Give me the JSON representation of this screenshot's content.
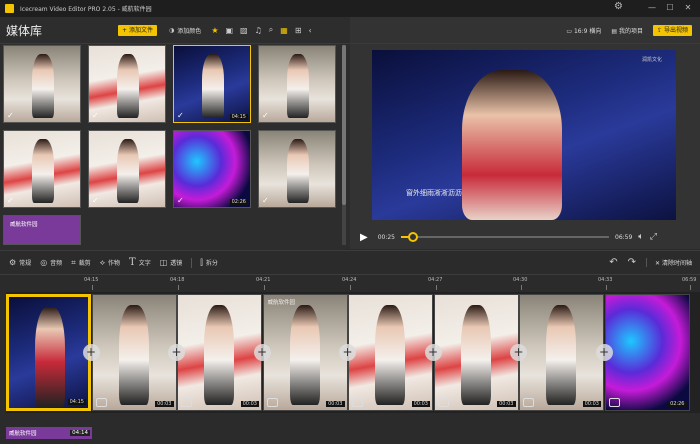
{
  "window": {
    "title": "Icecream Video Editor PRO 2.05 - 威航软件园"
  },
  "media": {
    "title": "媒体库",
    "add_file": "添加文件",
    "add_color": "添加颜色",
    "items": [
      {
        "style": "room",
        "checked": true,
        "duration": ""
      },
      {
        "style": "bed",
        "checked": true,
        "duration": ""
      },
      {
        "style": "stage",
        "checked": true,
        "duration": "04:15",
        "selected": true
      },
      {
        "style": "room",
        "checked": true,
        "duration": ""
      },
      {
        "style": "bed",
        "checked": true,
        "duration": ""
      },
      {
        "style": "bed",
        "checked": true,
        "duration": ""
      },
      {
        "style": "neon",
        "checked": true,
        "duration": "02:26"
      },
      {
        "style": "room",
        "checked": true,
        "duration": ""
      },
      {
        "style": "purple",
        "checked": false,
        "duration": "",
        "label": "威航软件园"
      }
    ]
  },
  "preview": {
    "aspect": "16:9 横向",
    "my_projects": "我的项目",
    "export": "导出视频",
    "caption": "窗外细雨淅淅沥沥",
    "watermark": "润凯文化",
    "current_time": "00:25",
    "total_time": "06:59",
    "progress": 0.06
  },
  "toolbar": {
    "general": "常规",
    "audio": "音频",
    "crop": "裁剪",
    "effects": "作物",
    "text": "文字",
    "transition": "透镜",
    "split": "拆分",
    "clear": "清除时间轴"
  },
  "timeline": {
    "ticks": [
      "04:15",
      "04:18",
      "04:21",
      "04:24",
      "04:27",
      "04:30",
      "04:33",
      "06:59"
    ],
    "clips": [
      {
        "style": "stage",
        "duration": "04:15",
        "active": true
      },
      {
        "style": "room",
        "duration": "00:03"
      },
      {
        "style": "bed",
        "duration": "00:03"
      },
      {
        "style": "room",
        "duration": "00:03",
        "label": "威航软件园"
      },
      {
        "style": "bed",
        "duration": "00:03"
      },
      {
        "style": "bed",
        "duration": "00:03"
      },
      {
        "style": "room",
        "duration": "00:03"
      },
      {
        "style": "neon",
        "duration": "02:26"
      }
    ],
    "text_track": {
      "label": "威航软件园",
      "duration": "04:14"
    }
  }
}
